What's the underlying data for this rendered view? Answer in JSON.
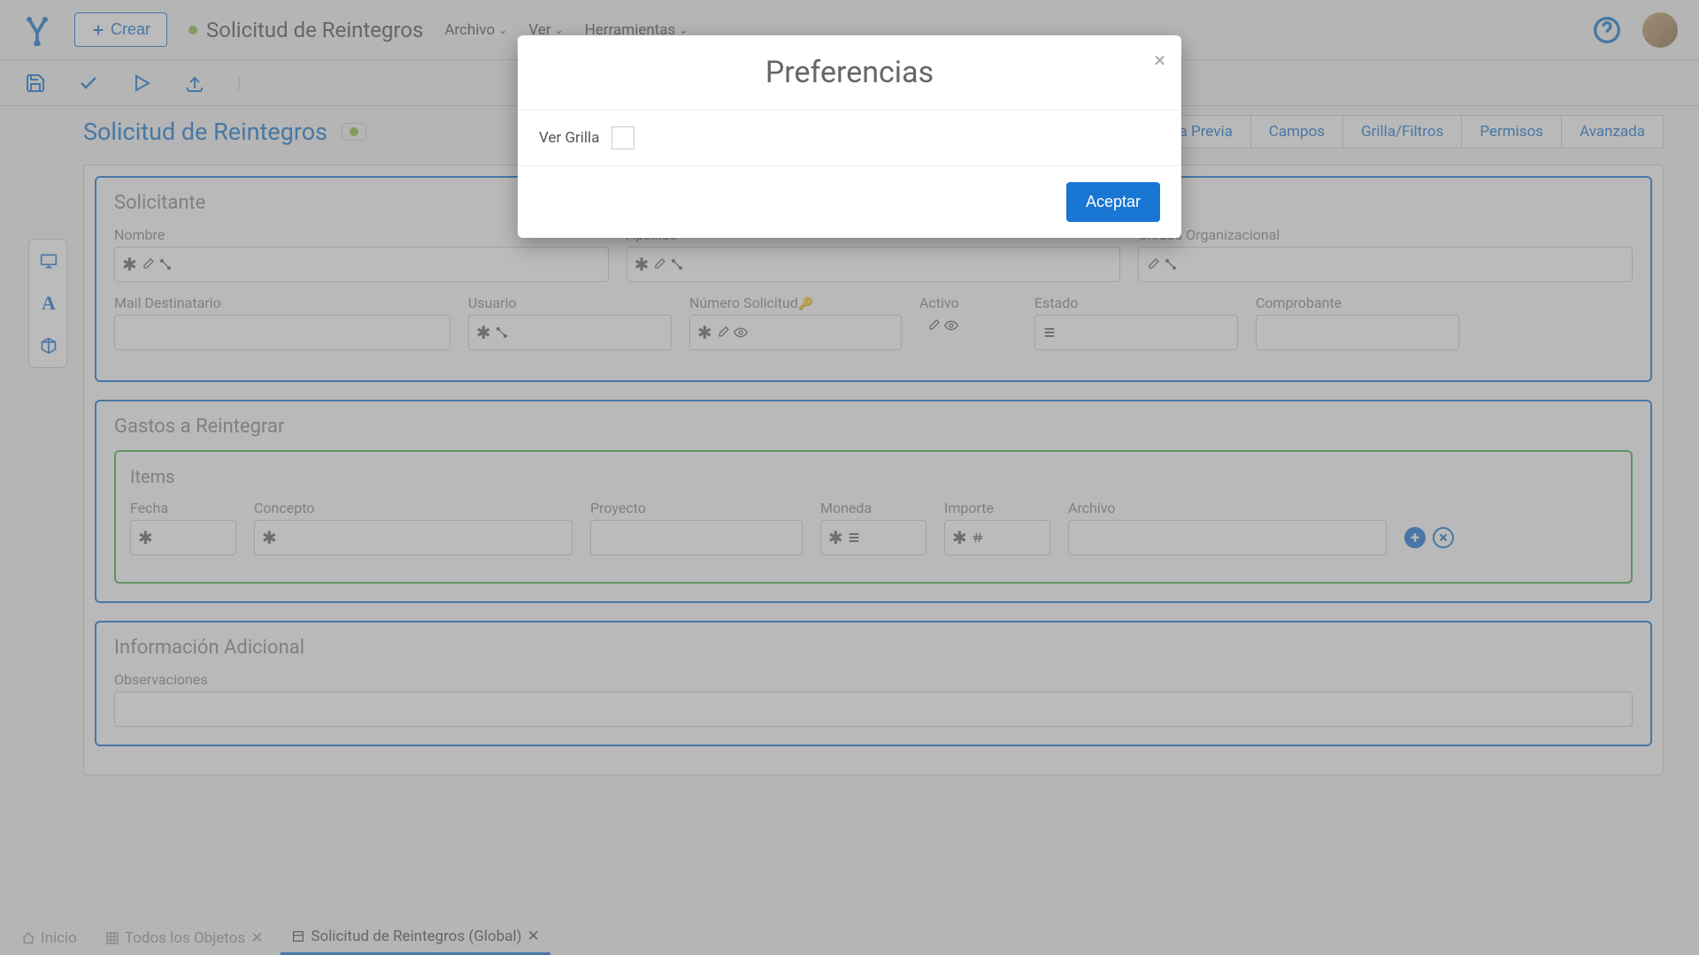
{
  "header": {
    "create": "Crear",
    "title": "Solicitud de Reintegros",
    "menus": {
      "file": "Archivo",
      "view": "Ver",
      "tools": "Herramientas"
    }
  },
  "form": {
    "title": "Solicitud de Reintegros",
    "tabs": {
      "preview": "Vista Previa",
      "fields": "Campos",
      "grid": "Grilla/Filtros",
      "perms": "Permisos",
      "adv": "Avanzada"
    }
  },
  "sections": {
    "solicitante": {
      "title": "Solicitante",
      "fields": {
        "nombre": "Nombre",
        "apellido": "Apellido",
        "uo": "Unidad Organizacional",
        "mail": "Mail Destinatario",
        "usuario": "Usuario",
        "numero": "Número Solicitud",
        "activo": "Activo",
        "estado": "Estado",
        "comprobante": "Comprobante"
      }
    },
    "gastos": {
      "title": "Gastos a Reintegrar",
      "items_title": "Items",
      "fields": {
        "fecha": "Fecha",
        "concepto": "Concepto",
        "proyecto": "Proyecto",
        "moneda": "Moneda",
        "importe": "Importe",
        "archivo": "Archivo"
      }
    },
    "info": {
      "title": "Información Adicional",
      "obs": "Observaciones"
    }
  },
  "modal": {
    "title": "Preferencias",
    "ver_grilla": "Ver Grilla",
    "accept": "Aceptar"
  },
  "bottom": {
    "inicio": "Inicio",
    "todos": "Todos los Objetos",
    "current": "Solicitud de Reintegros (Global)"
  }
}
